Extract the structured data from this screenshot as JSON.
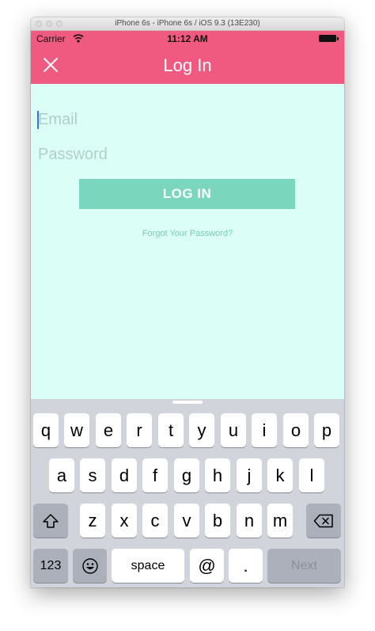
{
  "window": {
    "title": "iPhone 6s - iPhone 6s / iOS 9.3 (13E230)"
  },
  "status_bar": {
    "carrier": "Carrier",
    "time": "11:12 AM"
  },
  "nav": {
    "title": "Log In",
    "close_icon": "close-icon"
  },
  "form": {
    "email_placeholder": "Email",
    "email_value": "",
    "password_placeholder": "Password",
    "password_value": "",
    "login_label": "LOG IN",
    "forgot_label": "Forgot Your Password?"
  },
  "keyboard": {
    "row1": [
      "q",
      "w",
      "e",
      "r",
      "t",
      "y",
      "u",
      "i",
      "o",
      "p"
    ],
    "row2": [
      "a",
      "s",
      "d",
      "f",
      "g",
      "h",
      "j",
      "k",
      "l"
    ],
    "row3": [
      "z",
      "x",
      "c",
      "v",
      "b",
      "n",
      "m"
    ],
    "numbers_label": "123",
    "space_label": "space",
    "at_label": "@",
    "dot_label": ".",
    "next_label": "Next",
    "shift_icon": "shift-icon",
    "delete_icon": "backspace-icon",
    "emoji_icon": "emoji-icon"
  },
  "colors": {
    "header": "#f15a80",
    "content_bg": "#dbfff7",
    "button": "#7ad6bd",
    "link": "#74cdb6",
    "keyboard_bg": "#d1d5db"
  }
}
